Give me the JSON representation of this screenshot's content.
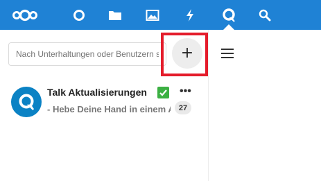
{
  "header": {
    "apps": [
      {
        "icon": "nextcloud-logo-icon"
      },
      {
        "icon": "dashboard-circle-icon"
      },
      {
        "icon": "files-folder-icon"
      },
      {
        "icon": "photos-image-icon"
      },
      {
        "icon": "activity-bolt-icon"
      },
      {
        "icon": "talk-icon",
        "active": true
      },
      {
        "icon": "search-icon"
      }
    ],
    "background_color": "#1f82d5"
  },
  "search": {
    "placeholder": "Nach Unterhaltungen oder Benutzern suchen"
  },
  "new_conversation": {
    "label": "+"
  },
  "conversations": [
    {
      "title": "Talk Aktualisierungen",
      "title_emoji": "check-mark-icon",
      "last_message": "- Hebe Deine Hand in einem Anruf",
      "unread_count": "27",
      "actions_label": "•••"
    }
  ],
  "colors": {
    "accent": "#1f82d5",
    "highlight": "#e41c2b",
    "avatar": "#0b82c4"
  }
}
